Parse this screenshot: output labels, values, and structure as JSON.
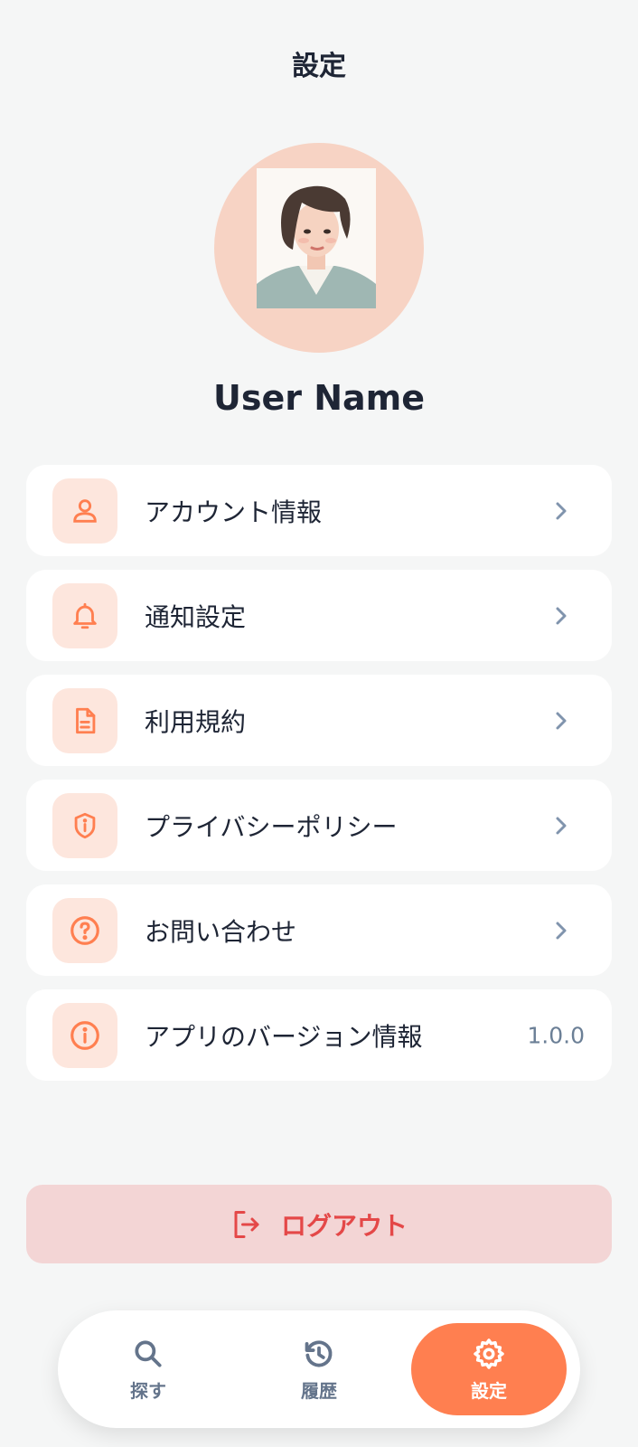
{
  "header": {
    "title": "設定"
  },
  "profile": {
    "name": "User Name",
    "avatar_alt": "avatar"
  },
  "menu": [
    {
      "label": "アカウント情報",
      "icon": "user-icon"
    },
    {
      "label": "通知設定",
      "icon": "bell-icon"
    },
    {
      "label": "利用規約",
      "icon": "document-icon"
    },
    {
      "label": "プライバシーポリシー",
      "icon": "shield-icon"
    },
    {
      "label": "お問い合わせ",
      "icon": "question-icon"
    },
    {
      "label": "アプリのバージョン情報",
      "icon": "info-icon",
      "value": "1.0.0"
    }
  ],
  "logout": {
    "label": "ログアウト",
    "icon": "logout-icon"
  },
  "tabbar": {
    "tabs": [
      {
        "label": "探す",
        "icon": "search-icon"
      },
      {
        "label": "履歴",
        "icon": "history-icon"
      },
      {
        "label": "設定",
        "icon": "gear-icon",
        "active": true
      }
    ]
  },
  "colors": {
    "accent": "#ff7f50",
    "icon_bg": "#fde6dd",
    "danger": "#e44848",
    "danger_bg": "#f3d5d5",
    "chevron": "#8094ad"
  }
}
